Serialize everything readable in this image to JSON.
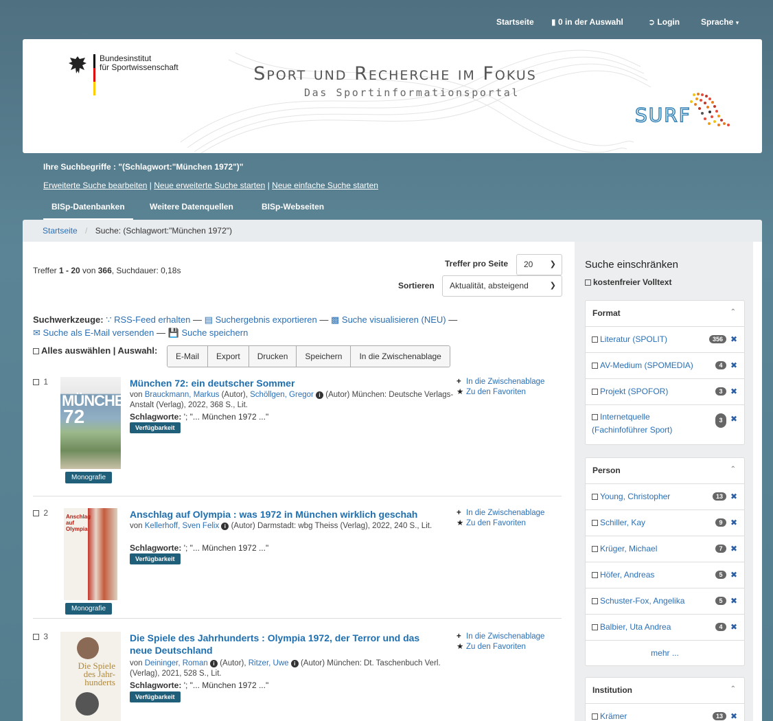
{
  "topnav": {
    "home": "Startseite",
    "selection": "0 in der Auswahl",
    "login": "Login",
    "language": "Sprache"
  },
  "header": {
    "institute_line1": "Bundesinstitut",
    "institute_line2": "für Sportwissenschaft",
    "title": "Sport und Recherche im Fokus",
    "subtitle": "Das Sportinformationsportal",
    "logo_text": "SURF"
  },
  "query": {
    "label": "Ihre Suchbegriffe : \"(Schlagwort:\"München 1972\")\"",
    "link_edit": "Erweiterte Suche bearbeiten",
    "link_new_advanced": "Neue erweiterte Suche starten",
    "link_new_simple": "Neue einfache Suche starten",
    "sep": "|"
  },
  "tabs": [
    "BISp-Datenbanken",
    "Weitere Datenquellen",
    "BISp-Webseiten"
  ],
  "breadcrumb": {
    "home": "Startseite",
    "sep": "/",
    "current": "Suche: (Schlagwort:\"München 1972\")"
  },
  "results_header": {
    "hits_prefix": "Treffer ",
    "hits_range": "1 - 20",
    "hits_of": " von ",
    "hits_total": "366",
    "duration": ", Suchdauer: 0,18s",
    "per_page_label": "Treffer pro Seite",
    "per_page_value": "20",
    "sort_label": "Sortieren",
    "sort_value": "Aktualität, absteigend"
  },
  "tools": {
    "label": "Suchwerkzeuge:",
    "rss": "RSS-Feed erhalten",
    "export": "Suchergebnis exportieren",
    "visualize": "Suche visualisieren (NEU)",
    "email": "Suche als E-Mail versenden",
    "save": "Suche speichern",
    "dash": "—"
  },
  "selection": {
    "select_all": "Alles auswählen | Auswahl:",
    "buttons": [
      "E-Mail",
      "Export",
      "Drucken",
      "Speichern",
      "In die Zwischenablage"
    ]
  },
  "results": [
    {
      "num": "1",
      "title": "München 72: ein deutscher Sommer",
      "by": "von ",
      "author1": "Brauckmann, Markus",
      "role1": " (Autor), ",
      "author2": "Schöllgen, Gregor",
      "role2": " (Autor) München: Deutsche Verlags-Anstalt (Verlag), 2022, 368 S., Lit.",
      "schlag_label": "Schlagworte:",
      "schlag_value": " '; \"... München  1972 ...\"",
      "avail": "Verfügbarkeit",
      "type": "Monografie",
      "act1": "In die Zwischenablage",
      "act2": "Zu den Favoriten"
    },
    {
      "num": "2",
      "title": "Anschlag auf Olympia : was 1972 in München wirklich geschah",
      "by": "von ",
      "author1": "Kellerhoff, Sven Felix",
      "role1": " (Autor) Darmstadt: wbg Theiss (Verlag), 2022, 240 S., Lit.",
      "schlag_label": "Schlagworte:",
      "schlag_value": " '; \"... München  1972 ...\"",
      "avail": "Verfügbarkeit",
      "type": "Monografie",
      "act1": "In die Zwischenablage",
      "act2": "Zu den Favoriten"
    },
    {
      "num": "3",
      "title": "Die Spiele des Jahrhunderts : Olympia 1972, der Terror und das neue Deutschland",
      "by": "von ",
      "author1": "Deininger, Roman",
      "role1": " (Autor), ",
      "author2": "Ritzer, Uwe",
      "role2": " (Autor) München: Dt. Taschenbuch Verl. (Verlag), 2021, 528 S., Lit.",
      "schlag_label": "Schlagworte:",
      "schlag_value": " '; \"... München  1972 ...\"",
      "avail": "Verfügbarkeit",
      "act1": "In die Zwischenablage",
      "act2": "Zu den Favoriten"
    }
  ],
  "covers": {
    "c1_line1": "MÜNCHEN",
    "c1_line2": "72",
    "c2_text": "Anschlag auf Olympia",
    "c3_line1": "Die Spiele",
    "c3_line2": "des Jahr-",
    "c3_line3": "hunderts"
  },
  "facets": {
    "heading": "Suche einschränken",
    "freetext": "kostenfreier Volltext",
    "format": {
      "title": "Format",
      "items": [
        {
          "label": "Literatur (SPOLIT)",
          "count": "356"
        },
        {
          "label": "AV-Medium (SPOMEDIA)",
          "count": "4"
        },
        {
          "label": "Projekt (SPOFOR)",
          "count": "3"
        },
        {
          "label": "Internetquelle",
          "label2": "(Fachinfoführer Sport)",
          "count": "3"
        }
      ]
    },
    "person": {
      "title": "Person",
      "items": [
        {
          "label": "Young, Christopher",
          "count": "13"
        },
        {
          "label": "Schiller, Kay",
          "count": "9"
        },
        {
          "label": "Krüger, Michael",
          "count": "7"
        },
        {
          "label": "Höfer, Andreas",
          "count": "5"
        },
        {
          "label": "Schuster-Fox, Angelika",
          "count": "5"
        },
        {
          "label": "Balbier, Uta Andrea",
          "count": "4"
        }
      ],
      "more": "mehr ..."
    },
    "institution": {
      "title": "Institution",
      "items": [
        {
          "label": "Krämer",
          "count": "13"
        }
      ]
    }
  }
}
